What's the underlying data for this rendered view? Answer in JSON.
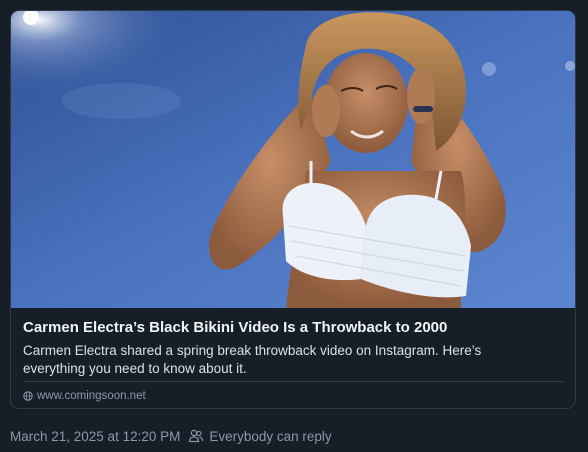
{
  "embed": {
    "image_alt": "Woman with wet hair in a white lace bikini top in the rain",
    "title": "Carmen Electra’s Black Bikini Video Is a Throwback to 2000",
    "description": "Carmen Electra shared a spring break throwback video on Instagram. Here’s everything you need to know about it.",
    "domain": "www.comingsoon.net",
    "domain_icon": "globe-icon"
  },
  "post_meta": {
    "timestamp": "March 21, 2025 at 12:20 PM",
    "reply_setting": "Everybody can reply",
    "reply_icon": "people-icon"
  },
  "colors": {
    "background": "#161e27",
    "border": "#2e3a48",
    "title_text": "#f1f3f5",
    "muted_text": "#8b98a9"
  }
}
